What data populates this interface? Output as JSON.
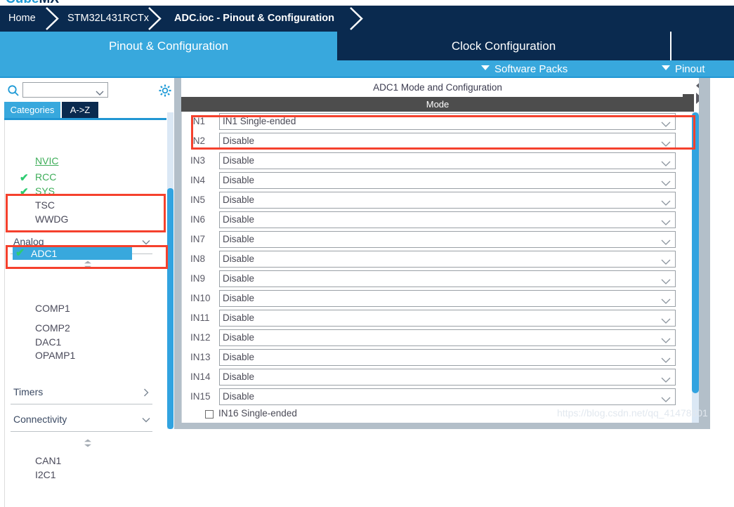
{
  "app": {
    "logo_primary": "Cube",
    "logo_secondary": "MX"
  },
  "breadcrumb": {
    "items": [
      {
        "label": "Home"
      },
      {
        "label": "STM32L431RCTx"
      },
      {
        "label": "ADC.ioc - Pinout & Configuration"
      }
    ]
  },
  "tabs": [
    {
      "label": "Pinout & Configuration",
      "selected": true
    },
    {
      "label": "Clock Configuration",
      "selected": false
    },
    {
      "label": "",
      "selected": false
    }
  ],
  "subbar": {
    "software_packs": "Software Packs",
    "pinout": "Pinout"
  },
  "sidebar": {
    "search": {
      "value": "",
      "placeholder": ""
    },
    "category_tabs": [
      {
        "label": "Categories",
        "selected": true
      },
      {
        "label": "A->Z",
        "selected": false
      }
    ],
    "system_peripherals": [
      {
        "label": "NVIC",
        "state": "green-underline",
        "checked": false
      },
      {
        "label": "RCC",
        "state": "green",
        "checked": true
      },
      {
        "label": "SYS",
        "state": "green",
        "checked": true
      },
      {
        "label": "TSC",
        "state": "dark",
        "checked": false
      },
      {
        "label": "WWDG",
        "state": "dark",
        "checked": false
      }
    ],
    "sections": [
      {
        "label": "Analog",
        "expanded": true
      },
      {
        "label": "Timers",
        "expanded": false
      },
      {
        "label": "Connectivity",
        "expanded": true
      }
    ],
    "analog_items": [
      {
        "label": "ADC1",
        "selected": true,
        "checked": true
      },
      {
        "label": "COMP1",
        "selected": false,
        "checked": false
      },
      {
        "label": "COMP2",
        "selected": false,
        "checked": false
      },
      {
        "label": "DAC1",
        "selected": false,
        "checked": false
      },
      {
        "label": "OPAMP1",
        "selected": false,
        "checked": false
      }
    ],
    "connectivity_items": [
      {
        "label": "CAN1",
        "selected": false,
        "checked": false
      },
      {
        "label": "I2C1",
        "selected": false,
        "checked": false
      }
    ]
  },
  "main": {
    "title": "ADC1 Mode and Configuration",
    "mode_header": "Mode",
    "rows": [
      {
        "label": "IN1",
        "value": "IN1 Single-ended"
      },
      {
        "label": "IN2",
        "value": "Disable"
      },
      {
        "label": "IN3",
        "value": "Disable"
      },
      {
        "label": "IN4",
        "value": "Disable"
      },
      {
        "label": "IN5",
        "value": "Disable"
      },
      {
        "label": "IN6",
        "value": "Disable"
      },
      {
        "label": "IN7",
        "value": "Disable"
      },
      {
        "label": "IN8",
        "value": "Disable"
      },
      {
        "label": "IN9",
        "value": "Disable"
      },
      {
        "label": "IN10",
        "value": "Disable"
      },
      {
        "label": "IN11",
        "value": "Disable"
      },
      {
        "label": "IN12",
        "value": "Disable"
      },
      {
        "label": "IN13",
        "value": "Disable"
      },
      {
        "label": "IN14",
        "value": "Disable"
      },
      {
        "label": "IN15",
        "value": "Disable"
      }
    ],
    "checkbox_row": {
      "label": "IN16 Single-ended",
      "checked": false
    }
  },
  "watermark": "https://blog.csdn.net/qq_41478801",
  "colors": {
    "brand_dark": "#0a2a4f",
    "brand_light": "#38a8dd",
    "mode_header": "#4d4d4d",
    "annotation": "#f5412d",
    "check_green": "#2ecc71",
    "peripheral_green": "#3fae5a"
  }
}
